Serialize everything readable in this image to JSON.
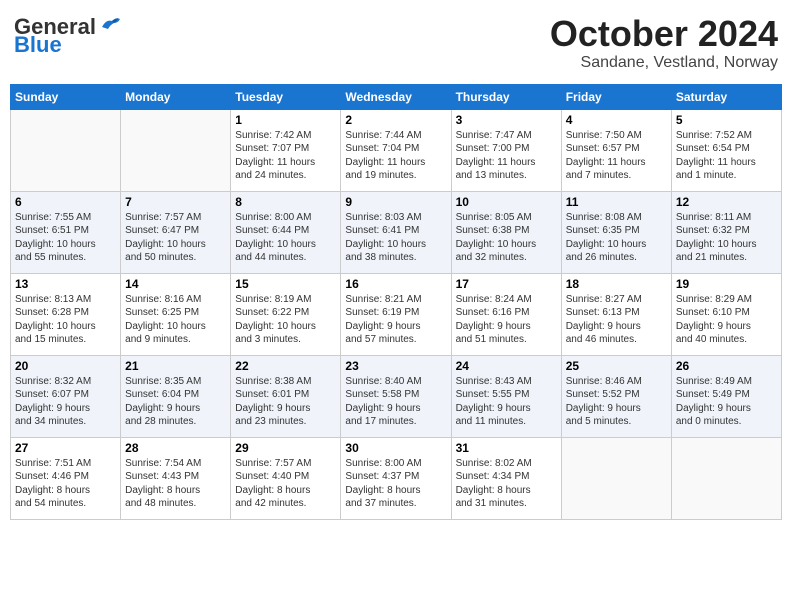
{
  "header": {
    "logo_general": "General",
    "logo_blue": "Blue",
    "month": "October 2024",
    "location": "Sandane, Vestland, Norway"
  },
  "days_of_week": [
    "Sunday",
    "Monday",
    "Tuesday",
    "Wednesday",
    "Thursday",
    "Friday",
    "Saturday"
  ],
  "weeks": [
    [
      {
        "day": "",
        "content": ""
      },
      {
        "day": "",
        "content": ""
      },
      {
        "day": "1",
        "content": "Sunrise: 7:42 AM\nSunset: 7:07 PM\nDaylight: 11 hours\nand 24 minutes."
      },
      {
        "day": "2",
        "content": "Sunrise: 7:44 AM\nSunset: 7:04 PM\nDaylight: 11 hours\nand 19 minutes."
      },
      {
        "day": "3",
        "content": "Sunrise: 7:47 AM\nSunset: 7:00 PM\nDaylight: 11 hours\nand 13 minutes."
      },
      {
        "day": "4",
        "content": "Sunrise: 7:50 AM\nSunset: 6:57 PM\nDaylight: 11 hours\nand 7 minutes."
      },
      {
        "day": "5",
        "content": "Sunrise: 7:52 AM\nSunset: 6:54 PM\nDaylight: 11 hours\nand 1 minute."
      }
    ],
    [
      {
        "day": "6",
        "content": "Sunrise: 7:55 AM\nSunset: 6:51 PM\nDaylight: 10 hours\nand 55 minutes."
      },
      {
        "day": "7",
        "content": "Sunrise: 7:57 AM\nSunset: 6:47 PM\nDaylight: 10 hours\nand 50 minutes."
      },
      {
        "day": "8",
        "content": "Sunrise: 8:00 AM\nSunset: 6:44 PM\nDaylight: 10 hours\nand 44 minutes."
      },
      {
        "day": "9",
        "content": "Sunrise: 8:03 AM\nSunset: 6:41 PM\nDaylight: 10 hours\nand 38 minutes."
      },
      {
        "day": "10",
        "content": "Sunrise: 8:05 AM\nSunset: 6:38 PM\nDaylight: 10 hours\nand 32 minutes."
      },
      {
        "day": "11",
        "content": "Sunrise: 8:08 AM\nSunset: 6:35 PM\nDaylight: 10 hours\nand 26 minutes."
      },
      {
        "day": "12",
        "content": "Sunrise: 8:11 AM\nSunset: 6:32 PM\nDaylight: 10 hours\nand 21 minutes."
      }
    ],
    [
      {
        "day": "13",
        "content": "Sunrise: 8:13 AM\nSunset: 6:28 PM\nDaylight: 10 hours\nand 15 minutes."
      },
      {
        "day": "14",
        "content": "Sunrise: 8:16 AM\nSunset: 6:25 PM\nDaylight: 10 hours\nand 9 minutes."
      },
      {
        "day": "15",
        "content": "Sunrise: 8:19 AM\nSunset: 6:22 PM\nDaylight: 10 hours\nand 3 minutes."
      },
      {
        "day": "16",
        "content": "Sunrise: 8:21 AM\nSunset: 6:19 PM\nDaylight: 9 hours\nand 57 minutes."
      },
      {
        "day": "17",
        "content": "Sunrise: 8:24 AM\nSunset: 6:16 PM\nDaylight: 9 hours\nand 51 minutes."
      },
      {
        "day": "18",
        "content": "Sunrise: 8:27 AM\nSunset: 6:13 PM\nDaylight: 9 hours\nand 46 minutes."
      },
      {
        "day": "19",
        "content": "Sunrise: 8:29 AM\nSunset: 6:10 PM\nDaylight: 9 hours\nand 40 minutes."
      }
    ],
    [
      {
        "day": "20",
        "content": "Sunrise: 8:32 AM\nSunset: 6:07 PM\nDaylight: 9 hours\nand 34 minutes."
      },
      {
        "day": "21",
        "content": "Sunrise: 8:35 AM\nSunset: 6:04 PM\nDaylight: 9 hours\nand 28 minutes."
      },
      {
        "day": "22",
        "content": "Sunrise: 8:38 AM\nSunset: 6:01 PM\nDaylight: 9 hours\nand 23 minutes."
      },
      {
        "day": "23",
        "content": "Sunrise: 8:40 AM\nSunset: 5:58 PM\nDaylight: 9 hours\nand 17 minutes."
      },
      {
        "day": "24",
        "content": "Sunrise: 8:43 AM\nSunset: 5:55 PM\nDaylight: 9 hours\nand 11 minutes."
      },
      {
        "day": "25",
        "content": "Sunrise: 8:46 AM\nSunset: 5:52 PM\nDaylight: 9 hours\nand 5 minutes."
      },
      {
        "day": "26",
        "content": "Sunrise: 8:49 AM\nSunset: 5:49 PM\nDaylight: 9 hours\nand 0 minutes."
      }
    ],
    [
      {
        "day": "27",
        "content": "Sunrise: 7:51 AM\nSunset: 4:46 PM\nDaylight: 8 hours\nand 54 minutes."
      },
      {
        "day": "28",
        "content": "Sunrise: 7:54 AM\nSunset: 4:43 PM\nDaylight: 8 hours\nand 48 minutes."
      },
      {
        "day": "29",
        "content": "Sunrise: 7:57 AM\nSunset: 4:40 PM\nDaylight: 8 hours\nand 42 minutes."
      },
      {
        "day": "30",
        "content": "Sunrise: 8:00 AM\nSunset: 4:37 PM\nDaylight: 8 hours\nand 37 minutes."
      },
      {
        "day": "31",
        "content": "Sunrise: 8:02 AM\nSunset: 4:34 PM\nDaylight: 8 hours\nand 31 minutes."
      },
      {
        "day": "",
        "content": ""
      },
      {
        "day": "",
        "content": ""
      }
    ]
  ]
}
